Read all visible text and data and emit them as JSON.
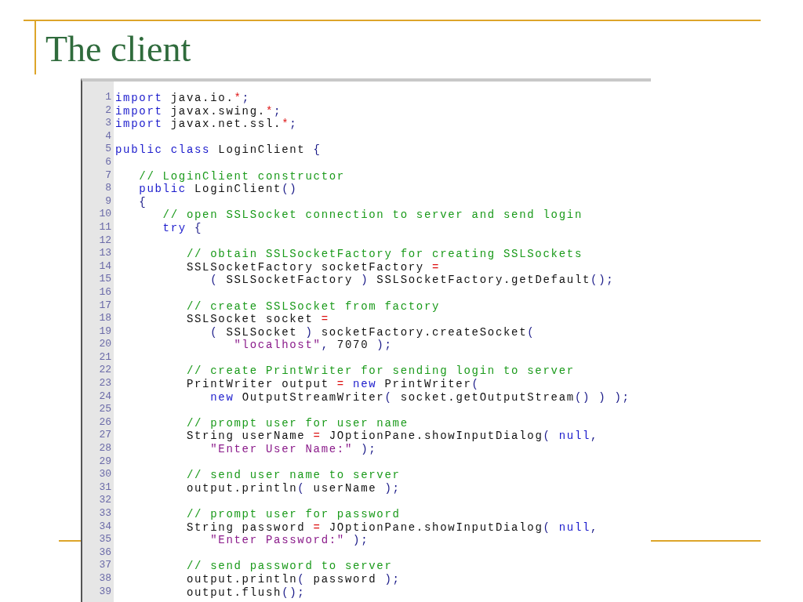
{
  "slide": {
    "title": "The client"
  },
  "code": {
    "lines": [
      {
        "number": "1",
        "tokens": [
          {
            "kind": "keyword",
            "text": "import"
          },
          {
            "kind": "text",
            "text": " java.io."
          },
          {
            "kind": "operator",
            "text": "*"
          },
          {
            "kind": "punct",
            "text": ";"
          }
        ]
      },
      {
        "number": "2",
        "tokens": [
          {
            "kind": "keyword",
            "text": "import"
          },
          {
            "kind": "text",
            "text": " javax.swing."
          },
          {
            "kind": "operator",
            "text": "*"
          },
          {
            "kind": "punct",
            "text": ";"
          }
        ]
      },
      {
        "number": "3",
        "tokens": [
          {
            "kind": "keyword",
            "text": "import"
          },
          {
            "kind": "text",
            "text": " javax.net.ssl."
          },
          {
            "kind": "operator",
            "text": "*"
          },
          {
            "kind": "punct",
            "text": ";"
          }
        ]
      },
      {
        "number": "4"
      },
      {
        "number": "5",
        "tokens": [
          {
            "kind": "keyword",
            "text": "public class"
          },
          {
            "kind": "text",
            "text": " LoginClient "
          },
          {
            "kind": "punct",
            "text": "{"
          }
        ]
      },
      {
        "number": "6"
      },
      {
        "number": "7",
        "tokens": [
          {
            "kind": "comment",
            "text": "   // LoginClient constructor"
          }
        ]
      },
      {
        "number": "8",
        "tokens": [
          {
            "kind": "keyword",
            "text": "   public"
          },
          {
            "kind": "text",
            "text": " LoginClient"
          },
          {
            "kind": "punct",
            "text": "()"
          }
        ]
      },
      {
        "number": "9",
        "tokens": [
          {
            "kind": "punct",
            "text": "   {"
          }
        ]
      },
      {
        "number": "10",
        "tokens": [
          {
            "kind": "comment",
            "text": "      // open SSLSocket connection to server and send login"
          }
        ]
      },
      {
        "number": "11",
        "tokens": [
          {
            "kind": "keyword",
            "text": "      try"
          },
          {
            "kind": "punct",
            "text": " {"
          }
        ]
      },
      {
        "number": "12"
      },
      {
        "number": "13",
        "tokens": [
          {
            "kind": "comment",
            "text": "         // obtain SSLSocketFactory for creating SSLSockets"
          }
        ]
      },
      {
        "number": "14",
        "tokens": [
          {
            "kind": "text",
            "text": "         SSLSocketFactory socketFactory "
          },
          {
            "kind": "operator",
            "text": "="
          }
        ]
      },
      {
        "number": "15",
        "tokens": [
          {
            "kind": "punct",
            "text": "            ( "
          },
          {
            "kind": "text",
            "text": "SSLSocketFactory "
          },
          {
            "kind": "punct",
            "text": ")"
          },
          {
            "kind": "text",
            "text": " SSLSocketFactory.getDefault"
          },
          {
            "kind": "punct",
            "text": "();"
          }
        ]
      },
      {
        "number": "16"
      },
      {
        "number": "17",
        "tokens": [
          {
            "kind": "comment",
            "text": "         // create SSLSocket from factory"
          }
        ]
      },
      {
        "number": "18",
        "tokens": [
          {
            "kind": "text",
            "text": "         SSLSocket socket "
          },
          {
            "kind": "operator",
            "text": "="
          }
        ]
      },
      {
        "number": "19",
        "tokens": [
          {
            "kind": "punct",
            "text": "            ( "
          },
          {
            "kind": "text",
            "text": "SSLSocket "
          },
          {
            "kind": "punct",
            "text": ")"
          },
          {
            "kind": "text",
            "text": " socketFactory.createSocket"
          },
          {
            "kind": "punct",
            "text": "("
          }
        ]
      },
      {
        "number": "20",
        "tokens": [
          {
            "kind": "string",
            "text": "               \"localhost\""
          },
          {
            "kind": "punct",
            "text": ", "
          },
          {
            "kind": "text",
            "text": "7070 "
          },
          {
            "kind": "punct",
            "text": ");"
          }
        ]
      },
      {
        "number": "21"
      },
      {
        "number": "22",
        "tokens": [
          {
            "kind": "comment",
            "text": "         // create PrintWriter for sending login to server"
          }
        ]
      },
      {
        "number": "23",
        "tokens": [
          {
            "kind": "text",
            "text": "         PrintWriter output "
          },
          {
            "kind": "operator",
            "text": "="
          },
          {
            "kind": "keyword",
            "text": " new"
          },
          {
            "kind": "text",
            "text": " PrintWriter"
          },
          {
            "kind": "punct",
            "text": "("
          }
        ]
      },
      {
        "number": "24",
        "tokens": [
          {
            "kind": "keyword",
            "text": "            new"
          },
          {
            "kind": "text",
            "text": " OutputStreamWriter"
          },
          {
            "kind": "punct",
            "text": "( "
          },
          {
            "kind": "text",
            "text": "socket.getOutputStream"
          },
          {
            "kind": "punct",
            "text": "() ) );"
          }
        ]
      },
      {
        "number": "25"
      },
      {
        "number": "26",
        "tokens": [
          {
            "kind": "comment",
            "text": "         // prompt user for user name"
          }
        ]
      },
      {
        "number": "27",
        "tokens": [
          {
            "kind": "text",
            "text": "         String userName "
          },
          {
            "kind": "operator",
            "text": "="
          },
          {
            "kind": "text",
            "text": " JOptionPane.showInputDialog"
          },
          {
            "kind": "punct",
            "text": "( "
          },
          {
            "kind": "keyword",
            "text": "null"
          },
          {
            "kind": "punct",
            "text": ","
          }
        ]
      },
      {
        "number": "28",
        "tokens": [
          {
            "kind": "string",
            "text": "            \"Enter User Name:\""
          },
          {
            "kind": "punct",
            "text": " );"
          }
        ]
      },
      {
        "number": "29"
      },
      {
        "number": "30",
        "tokens": [
          {
            "kind": "comment",
            "text": "         // send user name to server"
          }
        ]
      },
      {
        "number": "31",
        "tokens": [
          {
            "kind": "text",
            "text": "         output.println"
          },
          {
            "kind": "punct",
            "text": "( "
          },
          {
            "kind": "text",
            "text": "userName "
          },
          {
            "kind": "punct",
            "text": ");"
          }
        ]
      },
      {
        "number": "32"
      },
      {
        "number": "33",
        "tokens": [
          {
            "kind": "comment",
            "text": "         // prompt user for password"
          }
        ]
      },
      {
        "number": "34",
        "tokens": [
          {
            "kind": "text",
            "text": "         String password "
          },
          {
            "kind": "operator",
            "text": "="
          },
          {
            "kind": "text",
            "text": " JOptionPane.showInputDialog"
          },
          {
            "kind": "punct",
            "text": "( "
          },
          {
            "kind": "keyword",
            "text": "null"
          },
          {
            "kind": "punct",
            "text": ","
          }
        ]
      },
      {
        "number": "35",
        "tokens": [
          {
            "kind": "string",
            "text": "            \"Enter Password:\""
          },
          {
            "kind": "punct",
            "text": " );"
          }
        ]
      },
      {
        "number": "36"
      },
      {
        "number": "37",
        "tokens": [
          {
            "kind": "comment",
            "text": "         // send password to server"
          }
        ]
      },
      {
        "number": "38",
        "tokens": [
          {
            "kind": "text",
            "text": "         output.println"
          },
          {
            "kind": "punct",
            "text": "( "
          },
          {
            "kind": "text",
            "text": "password "
          },
          {
            "kind": "punct",
            "text": ");"
          }
        ]
      },
      {
        "number": "39",
        "tokens": [
          {
            "kind": "text",
            "text": "         output.flush"
          },
          {
            "kind": "punct",
            "text": "();"
          }
        ]
      }
    ]
  }
}
